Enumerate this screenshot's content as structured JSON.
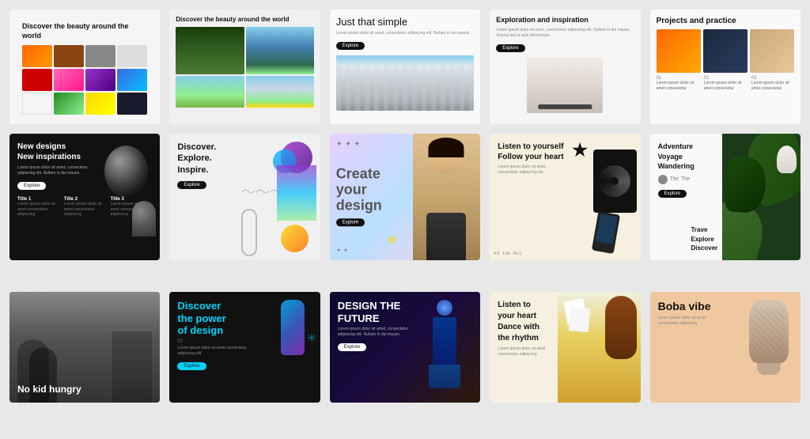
{
  "cards": {
    "r1c1": {
      "title": "Discover the beauty around the world",
      "swatches": [
        "orange",
        "brown",
        "grey",
        "light",
        "red",
        "pink",
        "purple",
        "blue",
        "white2",
        "green",
        "yellow",
        "dark"
      ]
    },
    "r1c2": {
      "title": "Discover the beauty around the world",
      "images": [
        "forest",
        "lake",
        "field",
        "mountain"
      ]
    },
    "r1c3": {
      "title": "Just that simple",
      "sub": "Lorem ipsum dolor sit amet, consectetur adipiscing elit. Nullam in dui mauris.",
      "btn": "Explore"
    },
    "r1c4": {
      "title": "Exploration and inspiration",
      "sub": "Lorem ipsum dolor sit amet, consectetur adipiscing elit. Nullam in dui mauris. Viverra nisl ut ante elementum."
    },
    "r1c5": {
      "title": "Projects and practice",
      "num1": "01",
      "num2": "02",
      "num3": "03",
      "sub1": "Lorem ipsum dolor sit amet consectetur",
      "sub2": "Lorem ipsum dolor sit amet consectetur",
      "sub3": "Lorem ipsum dolor sit amet consectetur"
    },
    "r2c1": {
      "title": "New designs\nNew inspirations",
      "sub": "Lorem ipsum dolor sit amet, consectetur adipiscing elit. Nullam in dui mauris.",
      "btn": "Explore",
      "col1": "Title 1",
      "col2": "Title 2",
      "col3": "Title 3",
      "col1sub": "Lorem ipsum dolor sit amet consectetur adipiscing",
      "col2sub": "Lorem ipsum dolor sit amet consectetur adipiscing",
      "col3sub": "Lorem ipsum dolor sit amet consectetur adipiscing"
    },
    "r2c2": {
      "title": "Discover.\nExplore.\nInspire.",
      "btn": "Explore"
    },
    "r2c3": {
      "title": "Create\nyour\ndesign",
      "btn": "Explore"
    },
    "r2c4": {
      "title": "Listen to yourself\nFollow your heart",
      "sub": "Lorem ipsum dolor sit amet, consectetur adipiscing elit.",
      "stars": "4.8",
      "downloads": "1.5k",
      "rating": "No.1"
    },
    "r2c5": {
      "title1": "Adventure\nVoyage\nWandering",
      "title2": "Trave\nExplore\nDiscover",
      "btn": "Explore"
    },
    "r3c1": {
      "title": "No kid hungry"
    },
    "r3c2": {
      "title": "Discover\nthe power\nof design",
      "num1": "01",
      "sub1": "Lorem ipsum dolor sit amet consectetur adipiscing elit",
      "btn": "Explore"
    },
    "r3c3": {
      "title": "DESIGN THE\nFUTURE",
      "sub": "Lorem ipsum dolor sit amet, consectetur adipiscing elit. Nullam in dui mauris.",
      "btn": "Explore"
    },
    "r3c4": {
      "title": "Listen to\nyour heart\nDance with\nthe rhythm",
      "sub": "Lorem ipsum dolor sit amet consectetur adipiscing"
    },
    "r3c5": {
      "title": "Boba vibe",
      "sub": "Lorem ipsum dolor sit amet consectetur adipiscing"
    }
  }
}
